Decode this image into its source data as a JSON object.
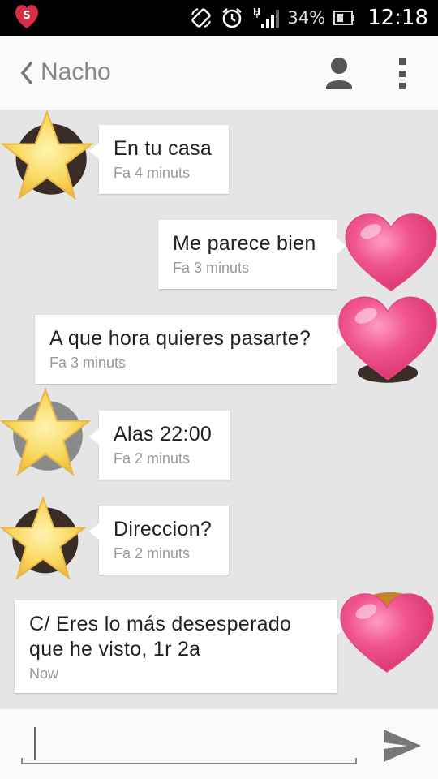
{
  "status_bar": {
    "app_icon": "heart-s-notification-icon",
    "icons": [
      "screen-rotate-icon",
      "alarm-clock-icon",
      "signal-h-icon",
      "battery-icon"
    ],
    "network_type": "H",
    "battery": "34%",
    "time": "12:18"
  },
  "app_bar": {
    "back_icon": "chevron-left-icon",
    "contact_name": "Nacho",
    "person_icon": "person-icon",
    "menu_icon": "overflow-menu-icon"
  },
  "messages": [
    {
      "direction": "incoming",
      "text": "En tu casa",
      "time": "Fa 4 minuts",
      "avatar": "star-avatar"
    },
    {
      "direction": "outgoing",
      "text": "Me parece bien",
      "time": "Fa 3 minuts",
      "avatar": "heart-avatar"
    },
    {
      "direction": "outgoing",
      "text": "A que hora quieres pasarte?",
      "time": "Fa 3 minuts",
      "avatar": "heart-avatar"
    },
    {
      "direction": "incoming",
      "text": "Alas 22:00",
      "time": "Fa 2 minuts",
      "avatar": "star-avatar"
    },
    {
      "direction": "incoming",
      "text": "Direccion?",
      "time": "Fa 2 minuts",
      "avatar": "star-avatar"
    },
    {
      "direction": "outgoing",
      "text_line1": "C/ Eres lo más desesperado",
      "text_line2": "que he visto, 1r 2a",
      "time": "Now",
      "avatar": "heart-avatar"
    }
  ],
  "compose": {
    "value": "",
    "send_icon": "send-icon"
  },
  "colors": {
    "status_bar_bg": "#000000",
    "app_bar_bg": "#fafafa",
    "chat_bg": "#e5e5e5",
    "bubble_bg": "#ffffff",
    "heart_pink": "#f0558f",
    "star_yellow": "#f7d35a"
  }
}
